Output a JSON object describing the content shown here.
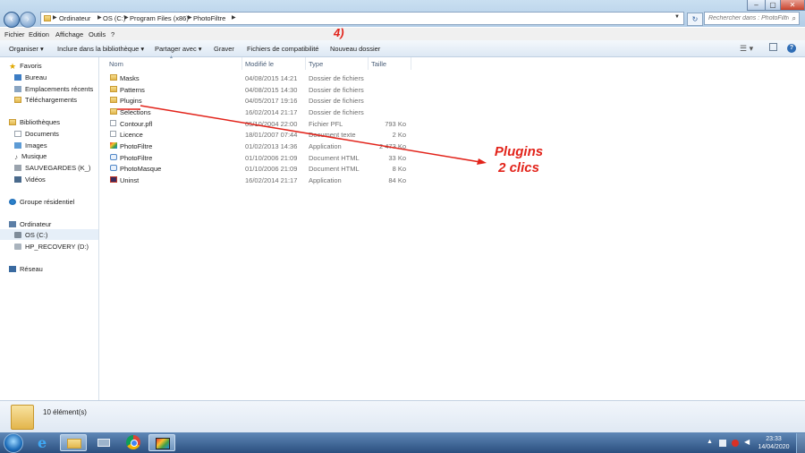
{
  "address_bar": {
    "crumbs": [
      "Ordinateur",
      "OS (C:)",
      "Program Files (x86)",
      "PhotoFiltre"
    ],
    "search_placeholder": "Rechercher dans : PhotoFiltre"
  },
  "menu": [
    "Fichier",
    "Edition",
    "Affichage",
    "Outils",
    "?"
  ],
  "toolbar": {
    "organize": "Organiser ▾",
    "include": "Inclure dans la bibliothèque ▾",
    "share": "Partager avec ▾",
    "burn": "Graver",
    "compat": "Fichiers de compatibilité",
    "new_folder": "Nouveau dossier"
  },
  "nav": {
    "favorites": "Favoris",
    "desktop": "Bureau",
    "recent": "Emplacements récents",
    "downloads": "Téléchargements",
    "libraries": "Bibliothèques",
    "documents": "Documents",
    "images": "Images",
    "music": "Musique",
    "sauvegardes": "SAUVEGARDES (K_)",
    "videos": "Vidéos",
    "homegroup": "Groupe résidentiel",
    "computer": "Ordinateur",
    "os_c": "OS (C:)",
    "hp_recovery": "HP_RECOVERY (D:)",
    "network": "Réseau"
  },
  "columns": {
    "name": "Nom",
    "modified": "Modifié le",
    "type": "Type",
    "size": "Taille"
  },
  "files": [
    {
      "name": "Masks",
      "date": "04/08/2015 14:21",
      "type": "Dossier de fichiers",
      "size": "",
      "icon": "folder"
    },
    {
      "name": "Patterns",
      "date": "04/08/2015 14:30",
      "type": "Dossier de fichiers",
      "size": "",
      "icon": "folder"
    },
    {
      "name": "Plugins",
      "date": "04/05/2017 19:16",
      "type": "Dossier de fichiers",
      "size": "",
      "icon": "folder"
    },
    {
      "name": "Selections",
      "date": "16/02/2014 21:17",
      "type": "Dossier de fichiers",
      "size": "",
      "icon": "folder"
    },
    {
      "name": "Contour.pfl",
      "date": "05/10/2004 22:00",
      "type": "Fichier PFL",
      "size": "793 Ko",
      "icon": "doc"
    },
    {
      "name": "Licence",
      "date": "18/01/2007 07:44",
      "type": "Document texte",
      "size": "2 Ko",
      "icon": "doc"
    },
    {
      "name": "PhotoFiltre",
      "date": "01/02/2013 14:36",
      "type": "Application",
      "size": "2 473 Ko",
      "icon": "app"
    },
    {
      "name": "PhotoFiltre",
      "date": "01/10/2006 21:09",
      "type": "Document HTML",
      "size": "33 Ko",
      "icon": "html"
    },
    {
      "name": "PhotoMasque",
      "date": "01/10/2006 21:09",
      "type": "Document HTML",
      "size": "8 Ko",
      "icon": "html"
    },
    {
      "name": "Uninst",
      "date": "16/02/2014 21:17",
      "type": "Application",
      "size": "84 Ko",
      "icon": "uninst"
    }
  ],
  "status": {
    "count": "10 élément(s)"
  },
  "annotation": {
    "step": "4)",
    "line1": "Plugins",
    "line2": "2 clics",
    "color": "#e2231a"
  },
  "clock": {
    "time": "23:33",
    "date": "14/04/2020"
  }
}
